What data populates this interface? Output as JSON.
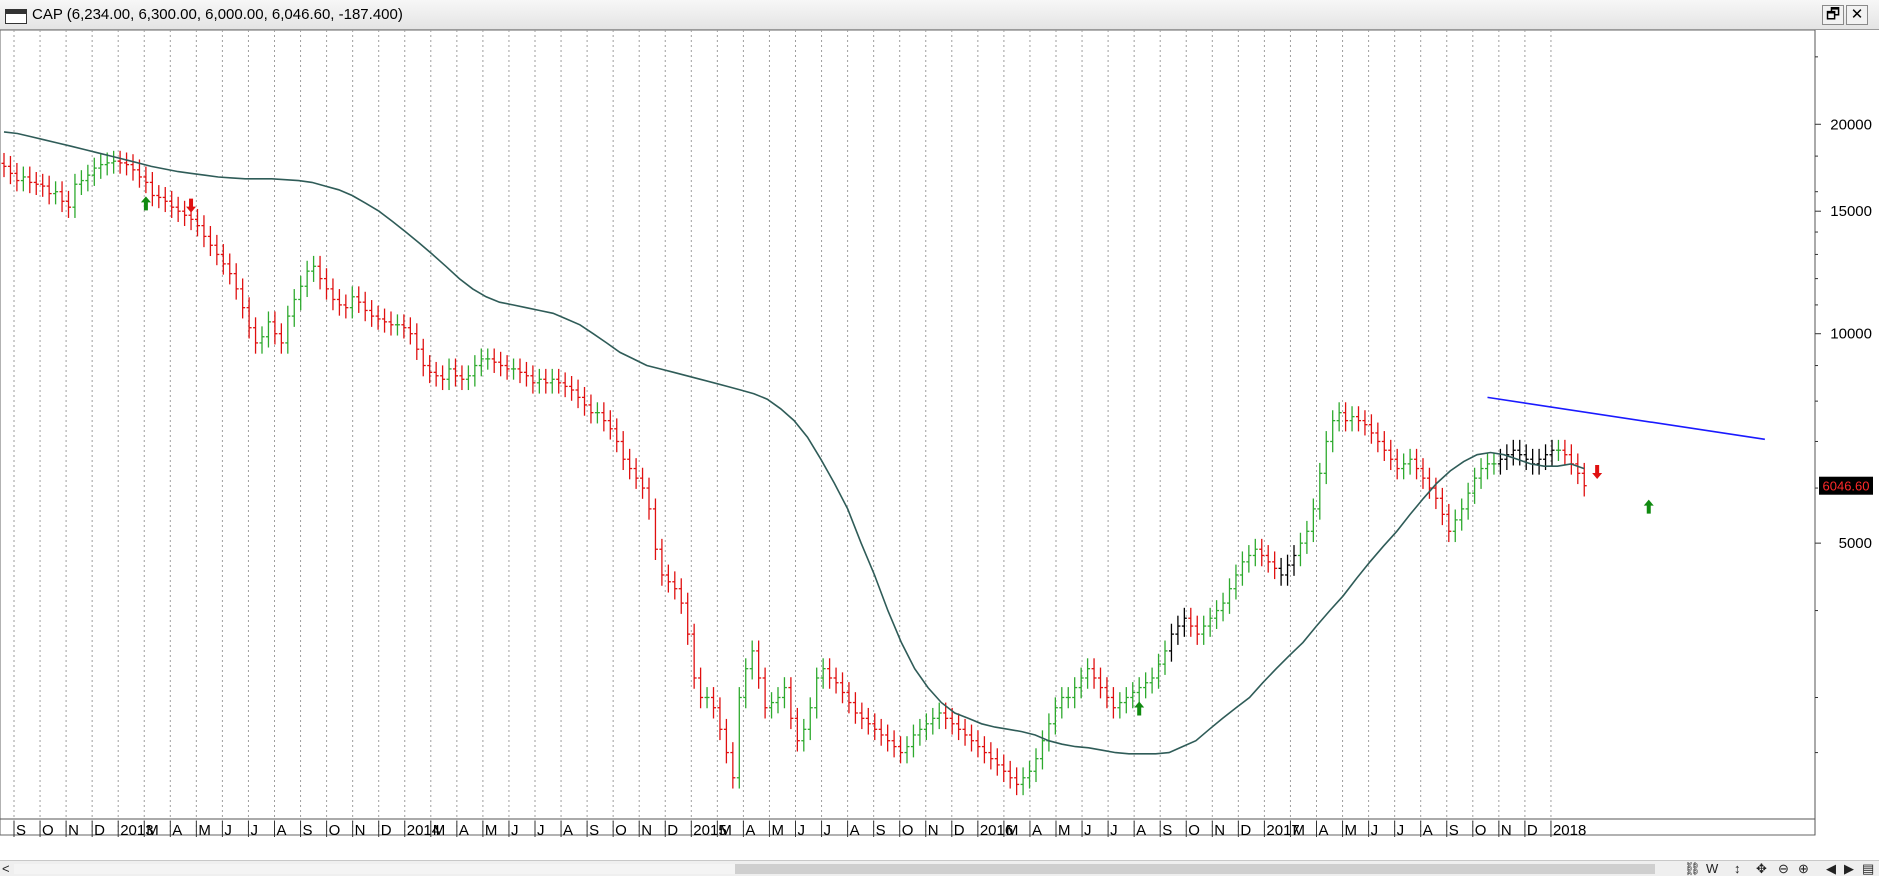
{
  "window": {
    "title": "CAP (6,234.00, 6,300.00, 6,000.00, 6,046.60, -187.400)",
    "restore_label": "🗗",
    "close_label": "✕"
  },
  "toolbar": {
    "scroll_left_label": "<",
    "icons": [
      "chain-icon",
      "weekly-label",
      "vertical-arrows-icon",
      "move-icon",
      "zoom-out-icon",
      "zoom-in-icon",
      "step-left-icon",
      "step-right-icon",
      "panel-icon"
    ],
    "weekly_label": "W"
  },
  "chart_data": {
    "type": "bar",
    "symbol": "CAP",
    "scale": "log",
    "ylim": [
      2000,
      26000
    ],
    "yticks": [
      {
        "value": 20000,
        "label": "20000"
      },
      {
        "value": 15000,
        "label": "15000"
      },
      {
        "value": 10000,
        "label": "10000"
      },
      {
        "value": 5000,
        "label": "5000"
      }
    ],
    "last_price_label": "6046.60",
    "last_price_value": 6046.6,
    "x_axis_labels": [
      "S",
      "O",
      "N",
      "D",
      "2013",
      "M",
      "A",
      "M",
      "J",
      "J",
      "A",
      "S",
      "O",
      "N",
      "D",
      "2014",
      "M",
      "A",
      "M",
      "J",
      "J",
      "A",
      "S",
      "O",
      "N",
      "D",
      "2015",
      "M",
      "A",
      "M",
      "J",
      "J",
      "A",
      "S",
      "O",
      "N",
      "D",
      "2016",
      "M",
      "A",
      "M",
      "J",
      "J",
      "A",
      "S",
      "O",
      "N",
      "D",
      "2017",
      "M",
      "A",
      "M",
      "J",
      "J",
      "A",
      "S",
      "O",
      "N",
      "D",
      "2018"
    ],
    "grid": "vertical-dotted",
    "series": [
      {
        "kind": "weekly-ohlc",
        "color_up": "#2eaa2e",
        "color_down": "#e01010",
        "color_neutral": "#000000",
        "close": [
          17400,
          17000,
          16600,
          16800,
          16500,
          16400,
          16300,
          15900,
          16000,
          15500,
          15200,
          16400,
          16600,
          16900,
          17300,
          17500,
          17600,
          17700,
          17600,
          17500,
          17200,
          16800,
          16500,
          15800,
          15700,
          15500,
          15200,
          15000,
          14800,
          14600,
          14300,
          13800,
          13400,
          13000,
          12600,
          12200,
          11600,
          10900,
          10200,
          9700,
          9900,
          10400,
          10000,
          9700,
          10600,
          11200,
          11700,
          12300,
          12500,
          12000,
          11600,
          11200,
          11000,
          10900,
          11300,
          11100,
          10800,
          10600,
          10500,
          10400,
          10300,
          10300,
          10200,
          10000,
          9500,
          9000,
          8800,
          8700,
          8600,
          8900,
          8700,
          8600,
          8700,
          9000,
          9200,
          9200,
          9100,
          9000,
          8900,
          8900,
          8800,
          8700,
          8500,
          8600,
          8500,
          8600,
          8500,
          8400,
          8300,
          8100,
          7900,
          7700,
          7700,
          7500,
          7300,
          7000,
          6600,
          6400,
          6200,
          6000,
          5600,
          4900,
          4500,
          4400,
          4300,
          4100,
          3700,
          3200,
          3000,
          3000,
          2900,
          2700,
          2500,
          2300,
          3000,
          3300,
          3500,
          3200,
          2900,
          2950,
          3000,
          3100,
          2800,
          2600,
          2700,
          2900,
          3200,
          3300,
          3200,
          3150,
          3050,
          2950,
          2850,
          2800,
          2750,
          2700,
          2650,
          2600,
          2550,
          2500,
          2550,
          2650,
          2700,
          2750,
          2800,
          2850,
          2800,
          2750,
          2700,
          2650,
          2600,
          2550,
          2500,
          2450,
          2400,
          2350,
          2300,
          2250,
          2300,
          2350,
          2450,
          2600,
          2750,
          2900,
          3000,
          3000,
          3100,
          3200,
          3300,
          3200,
          3100,
          3000,
          2900,
          2950,
          3000,
          3050,
          3100,
          3150,
          3200,
          3350,
          3500,
          3700,
          3800,
          3900,
          3800,
          3700,
          3800,
          3900,
          4000,
          4100,
          4300,
          4500,
          4700,
          4800,
          4900,
          4800,
          4700,
          4600,
          4500,
          4650,
          4800,
          5000,
          5200,
          5600,
          6300,
          7000,
          7500,
          7700,
          7500,
          7600,
          7500,
          7400,
          7200,
          7000,
          6800,
          6600,
          6400,
          6500,
          6600,
          6400,
          6200,
          6000,
          5800,
          5500,
          5200,
          5400,
          5600,
          5900,
          6200,
          6400,
          6500,
          6500,
          6600,
          6700,
          6800,
          6700,
          6600,
          6500,
          6600,
          6700,
          6800,
          6800,
          6700,
          6500,
          6300,
          6046.6
        ],
        "name": ""
      },
      {
        "kind": "moving-average",
        "color": "#2f5c58",
        "values": [
          19500,
          19400,
          19200,
          19000,
          18800,
          18600,
          18400,
          18200,
          18000,
          17800,
          17600,
          17400,
          17250,
          17100,
          17000,
          16900,
          16800,
          16750,
          16700,
          16700,
          16700,
          16650,
          16600,
          16500,
          16300,
          16100,
          15800,
          15400,
          15000,
          14500,
          14000,
          13500,
          13000,
          12500,
          12000,
          11600,
          11300,
          11100,
          11000,
          10900,
          10800,
          10700,
          10500,
          10300,
          10000,
          9700,
          9400,
          9200,
          9000,
          8900,
          8800,
          8700,
          8600,
          8500,
          8400,
          8300,
          8200,
          8050,
          7800,
          7500,
          7100,
          6600,
          6100,
          5600,
          5000,
          4500,
          4000,
          3600,
          3300,
          3100,
          2950,
          2850,
          2800,
          2750,
          2720,
          2700,
          2680,
          2650,
          2600,
          2570,
          2550,
          2540,
          2520,
          2500,
          2490,
          2490,
          2490,
          2500,
          2550,
          2600,
          2700,
          2800,
          2900,
          3000,
          3150,
          3300,
          3450,
          3600,
          3800,
          4000,
          4200,
          4450,
          4700,
          4950,
          5200,
          5500,
          5800,
          6100,
          6350,
          6550,
          6700,
          6750,
          6700,
          6600,
          6500,
          6450,
          6450,
          6500,
          6400
        ],
        "name": ""
      },
      {
        "kind": "trendline",
        "color": "#1a1aff",
        "from": {
          "week": 230,
          "value": 8100
        },
        "to": {
          "week": 273,
          "value": 7050
        },
        "name": ""
      }
    ],
    "signals": [
      {
        "week": 22,
        "type": "buy",
        "color": "#108a10"
      },
      {
        "week": 29,
        "type": "sell",
        "color": "#e01010"
      },
      {
        "week": 176,
        "type": "buy",
        "color": "#108a10"
      },
      {
        "week": 247,
        "type": "sell",
        "color": "#e01010"
      },
      {
        "week": 255,
        "type": "buy",
        "color": "#108a10"
      }
    ],
    "xlabel": "",
    "ylabel": ""
  }
}
